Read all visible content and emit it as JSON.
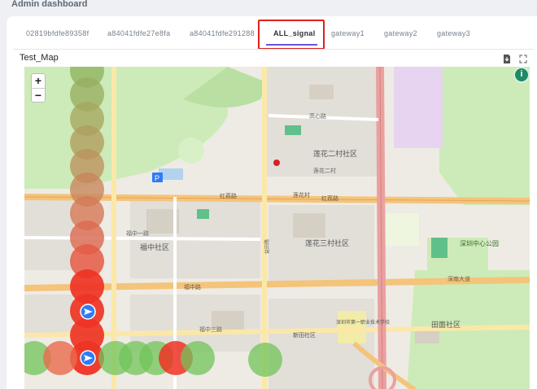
{
  "header": {
    "title": "Admin dashboard"
  },
  "tabs": [
    {
      "label": "02819bfdfe89358f",
      "active": false
    },
    {
      "label": "a84041fdfe27e8fa",
      "active": false
    },
    {
      "label": "a84041fdfe291288",
      "active": false
    },
    {
      "label": "ALL_signal",
      "active": true
    },
    {
      "label": "gateway1",
      "active": false
    },
    {
      "label": "gateway2",
      "active": false
    },
    {
      "label": "gateway3",
      "active": false
    }
  ],
  "map": {
    "title": "Test_Map",
    "zoom_in_label": "+",
    "zoom_out_label": "−",
    "info_icon": "info-icon",
    "toolbar_icons": [
      "download-icon",
      "fullscreen-icon"
    ],
    "labels": {
      "road_hongli": "红荔路",
      "road_hongli_e": "红荔路",
      "road_lianhua": "莲花路",
      "road_fuzhong": "福中路",
      "road_fuzhong1": "福中一路",
      "road_fuzhong3": "福中三路",
      "road_shennan": "深南大道",
      "road_yitian": "益田路",
      "road_gaoxin": "高心路",
      "village3": "莲花三村社区",
      "village2": "莲花二村社区",
      "village_short": "莲花二村",
      "fuzhong_community": "福中社区",
      "tianmian_community": "田面社区",
      "shenzhen_park": "深圳中心公园",
      "lianhua_village": "莲花村",
      "school": "深圳市第一职业技术学校",
      "xintian": "新田社区"
    },
    "colors": {
      "signal_strong": "#ee3324",
      "signal_weak": "#71c45a",
      "marker_blue": "#2f7cf6",
      "road_major": "#f4c47a",
      "road_primary": "#e9a1a0",
      "park": "#cdebb8"
    }
  }
}
